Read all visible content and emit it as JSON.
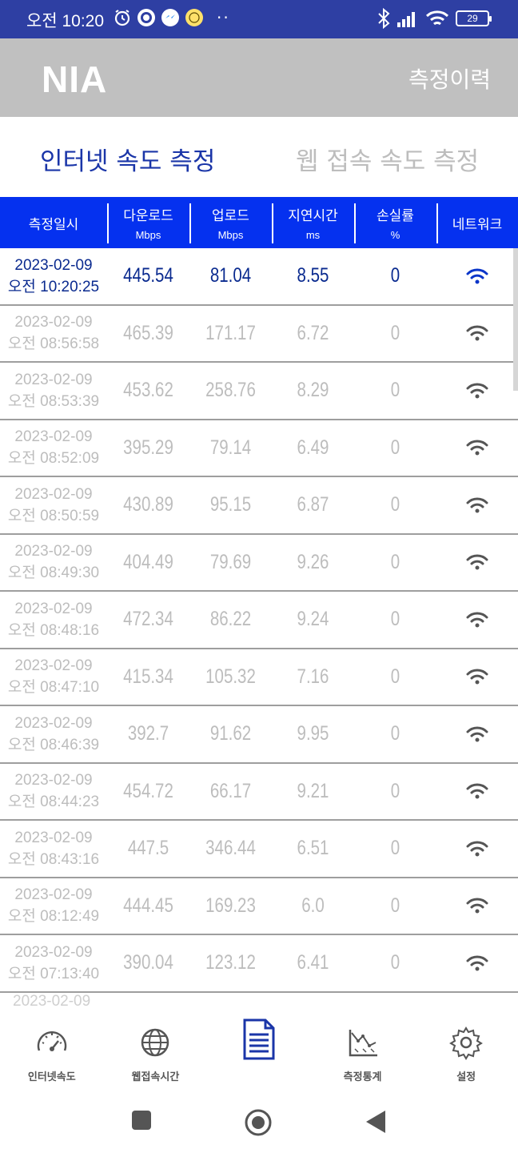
{
  "status_bar": {
    "time": "오전 10:20",
    "battery": "29"
  },
  "app_header": {
    "logo": "NIA",
    "history_button": "측정이력"
  },
  "tabs": [
    {
      "label": "인터넷 속도 측정",
      "active": true
    },
    {
      "label": "웹 접속 속도 측정",
      "active": false
    }
  ],
  "table": {
    "headers": [
      {
        "label": "측정일시",
        "unit": ""
      },
      {
        "label": "다운로드",
        "unit": "Mbps"
      },
      {
        "label": "업로드",
        "unit": "Mbps"
      },
      {
        "label": "지연시간",
        "unit": "ms"
      },
      {
        "label": "손실률",
        "unit": "%"
      },
      {
        "label": "네트워크",
        "unit": ""
      }
    ],
    "rows": [
      {
        "date": "2023-02-09",
        "time": "오전 10:20:25",
        "download": "445.54",
        "upload": "81.04",
        "latency": "8.55",
        "loss": "0",
        "network": "wifi-icon",
        "active": true
      },
      {
        "date": "2023-02-09",
        "time": "오전 08:56:58",
        "download": "465.39",
        "upload": "171.17",
        "latency": "6.72",
        "loss": "0",
        "network": "wifi-icon"
      },
      {
        "date": "2023-02-09",
        "time": "오전 08:53:39",
        "download": "453.62",
        "upload": "258.76",
        "latency": "8.29",
        "loss": "0",
        "network": "wifi-icon"
      },
      {
        "date": "2023-02-09",
        "time": "오전 08:52:09",
        "download": "395.29",
        "upload": "79.14",
        "latency": "6.49",
        "loss": "0",
        "network": "wifi-icon"
      },
      {
        "date": "2023-02-09",
        "time": "오전 08:50:59",
        "download": "430.89",
        "upload": "95.15",
        "latency": "6.87",
        "loss": "0",
        "network": "wifi-icon"
      },
      {
        "date": "2023-02-09",
        "time": "오전 08:49:30",
        "download": "404.49",
        "upload": "79.69",
        "latency": "9.26",
        "loss": "0",
        "network": "wifi-icon"
      },
      {
        "date": "2023-02-09",
        "time": "오전 08:48:16",
        "download": "472.34",
        "upload": "86.22",
        "latency": "9.24",
        "loss": "0",
        "network": "wifi-icon"
      },
      {
        "date": "2023-02-09",
        "time": "오전 08:47:10",
        "download": "415.34",
        "upload": "105.32",
        "latency": "7.16",
        "loss": "0",
        "network": "wifi-icon"
      },
      {
        "date": "2023-02-09",
        "time": "오전 08:46:39",
        "download": "392.7",
        "upload": "91.62",
        "latency": "9.95",
        "loss": "0",
        "network": "wifi-icon"
      },
      {
        "date": "2023-02-09",
        "time": "오전 08:44:23",
        "download": "454.72",
        "upload": "66.17",
        "latency": "9.21",
        "loss": "0",
        "network": "wifi-icon"
      },
      {
        "date": "2023-02-09",
        "time": "오전 08:43:16",
        "download": "447.5",
        "upload": "346.44",
        "latency": "6.51",
        "loss": "0",
        "network": "wifi-icon"
      },
      {
        "date": "2023-02-09",
        "time": "오전 08:12:49",
        "download": "444.45",
        "upload": "169.23",
        "latency": "6.0",
        "loss": "0",
        "network": "wifi-icon"
      },
      {
        "date": "2023-02-09",
        "time": "오전 07:13:40",
        "download": "390.04",
        "upload": "123.12",
        "latency": "6.41",
        "loss": "0",
        "network": "wifi-icon"
      }
    ],
    "partial_row_text": "2023-02-09"
  },
  "bottom_nav": [
    {
      "label": "인터넷속도",
      "icon": "speedometer-icon"
    },
    {
      "label": "웹접속시간",
      "icon": "globe-icon"
    },
    {
      "label": "",
      "icon": "document-icon",
      "active": true
    },
    {
      "label": "측정통계",
      "icon": "chart-icon"
    },
    {
      "label": "설정",
      "icon": "gear-icon"
    }
  ],
  "colors": {
    "status_bar": "#2e3fa3",
    "header_bg": "#c0c0c0",
    "table_header": "#0531ef",
    "active_text": "#0a2a8f",
    "inactive_text": "#bdbdbd",
    "nav_active": "#1a35a8"
  }
}
